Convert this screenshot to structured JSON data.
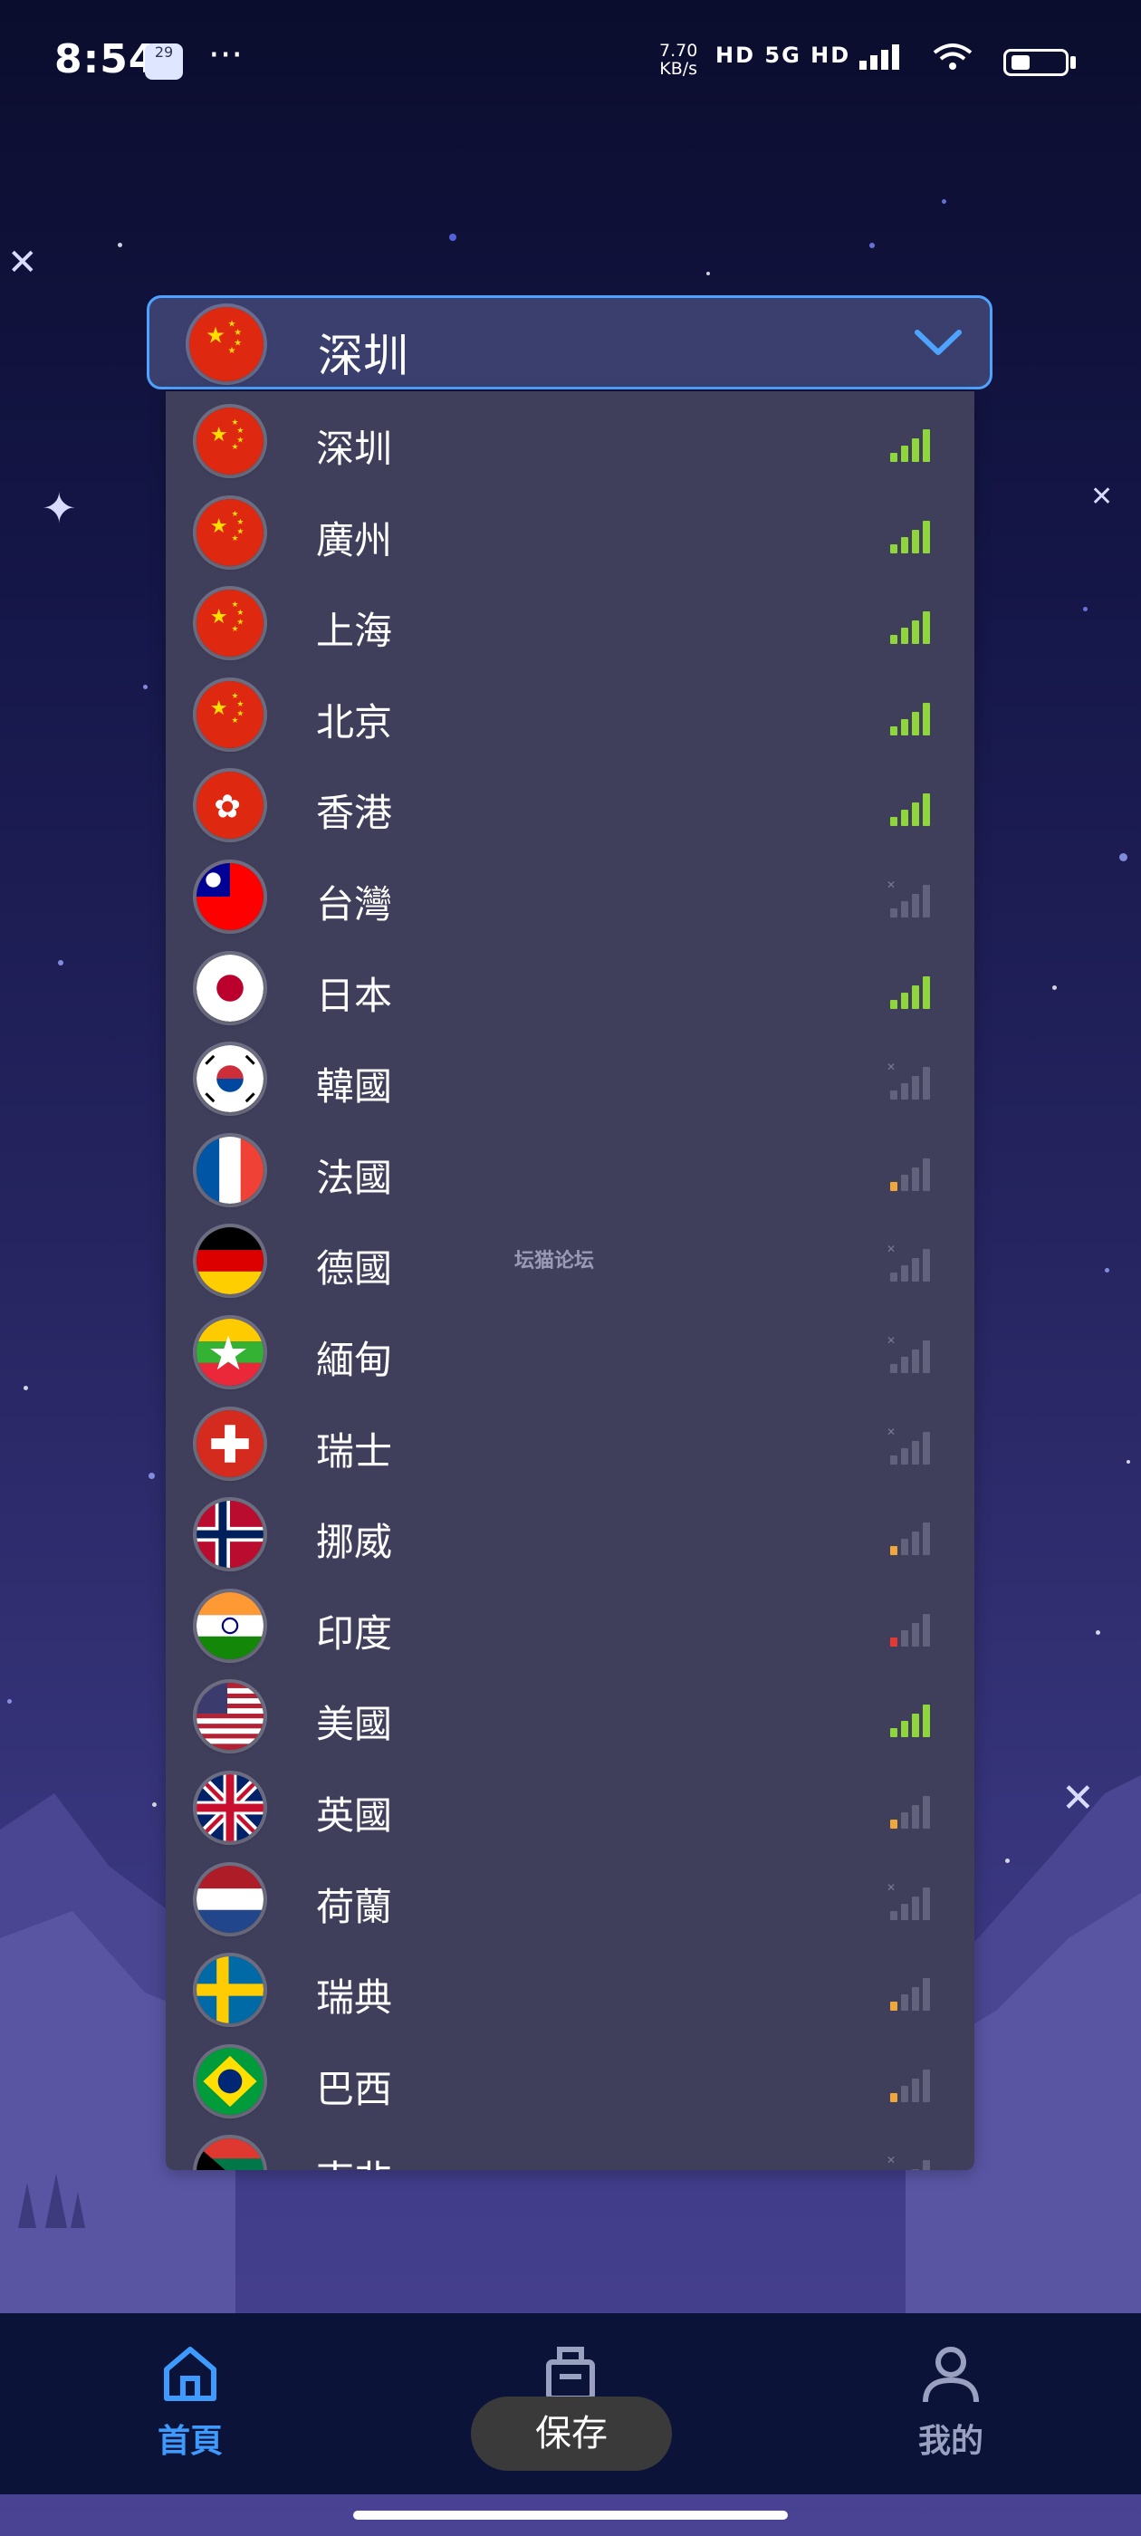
{
  "status_bar": {
    "time": "8:54",
    "date_badge": "29",
    "overflow": "···",
    "speed_value": "7.70",
    "speed_unit": "KB/s",
    "network_info": "HD 5G HD"
  },
  "selector": {
    "selected": "深圳",
    "flag": "cn-flag-icon"
  },
  "servers": [
    {
      "label": "深圳",
      "flag": "cn",
      "signal": "strong"
    },
    {
      "label": "廣州",
      "flag": "cn",
      "signal": "strong"
    },
    {
      "label": "上海",
      "flag": "cn",
      "signal": "strong"
    },
    {
      "label": "北京",
      "flag": "cn",
      "signal": "strong"
    },
    {
      "label": "香港",
      "flag": "hk",
      "signal": "strong"
    },
    {
      "label": "台灣",
      "flag": "tw",
      "signal": "none"
    },
    {
      "label": "日本",
      "flag": "jp",
      "signal": "strong"
    },
    {
      "label": "韓國",
      "flag": "kr",
      "signal": "none"
    },
    {
      "label": "法國",
      "flag": "fr",
      "signal": "weak"
    },
    {
      "label": "德國",
      "flag": "de",
      "signal": "none"
    },
    {
      "label": "緬甸",
      "flag": "mm",
      "signal": "none"
    },
    {
      "label": "瑞士",
      "flag": "ch",
      "signal": "none"
    },
    {
      "label": "挪威",
      "flag": "no",
      "signal": "weak"
    },
    {
      "label": "印度",
      "flag": "in",
      "signal": "poor"
    },
    {
      "label": "美國",
      "flag": "us",
      "signal": "strong"
    },
    {
      "label": "英國",
      "flag": "gb",
      "signal": "weak"
    },
    {
      "label": "荷蘭",
      "flag": "nl",
      "signal": "none"
    },
    {
      "label": "瑞典",
      "flag": "se",
      "signal": "weak"
    },
    {
      "label": "巴西",
      "flag": "br",
      "signal": "weak"
    },
    {
      "label": "南非",
      "flag": "za",
      "signal": "none"
    }
  ],
  "watermark": "坛猫论坛",
  "nav": {
    "home_label": "首頁",
    "save_label": "保存",
    "me_label": "我的"
  },
  "toast": "保存",
  "colors": {
    "accent": "#3d9bff",
    "signal_strong": "#8fd63a",
    "signal_weak": "#f0a73a",
    "signal_poor": "#e53935",
    "signal_off": "#7a7a92"
  }
}
